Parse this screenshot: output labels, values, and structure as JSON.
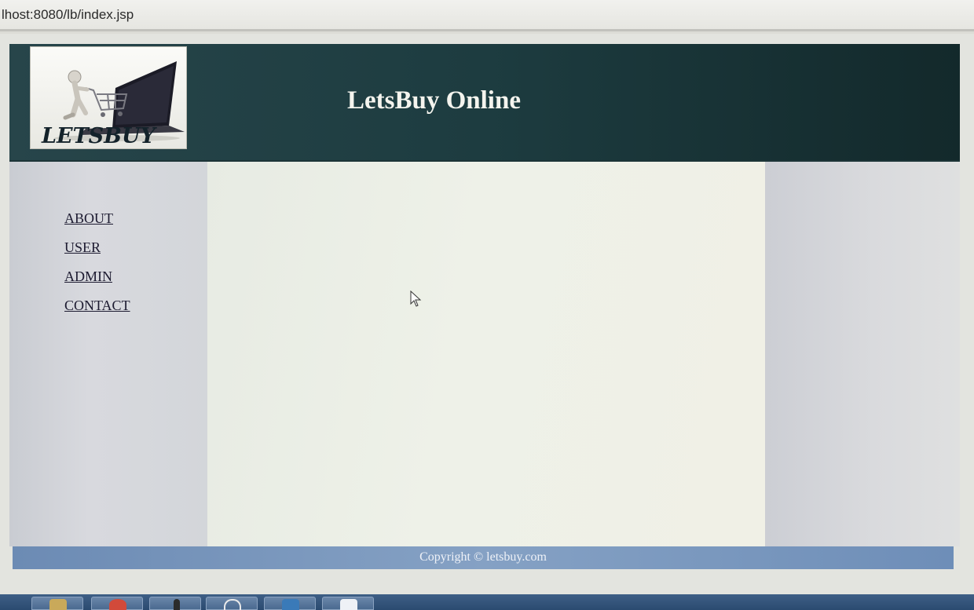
{
  "browser": {
    "url": "lhost:8080/lb/index.jsp"
  },
  "header": {
    "logo_text": "LETSBUY",
    "title": "LetsBuy Online"
  },
  "nav": {
    "items": [
      "ABOUT",
      "USER",
      "ADMIN",
      "CONTACT"
    ]
  },
  "footer": {
    "copyright": "Copyright © letsbuy.com"
  },
  "colors": {
    "header_bg": "#1f3e42",
    "footer_bg": "#7895bd",
    "sidebar_bg": "#d3d5da",
    "main_bg": "#eef0e7",
    "link": "#1c1a30"
  },
  "taskbar": {
    "buttons": [
      "folder-icon",
      "chrome-icon",
      "generic-app-icon",
      "app-icon",
      "database-icon",
      "word-icon"
    ]
  }
}
